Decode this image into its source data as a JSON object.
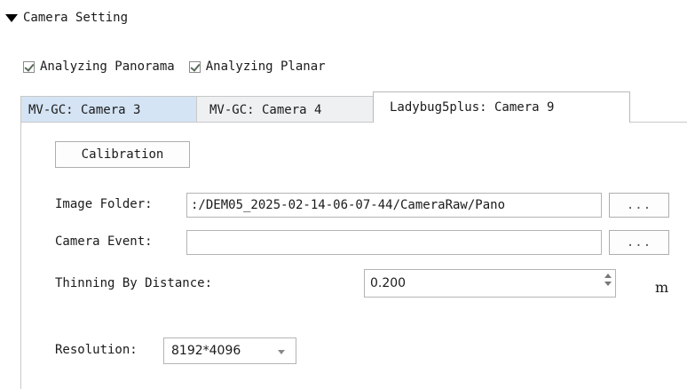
{
  "section": {
    "title": "Camera Setting"
  },
  "checkboxes": [
    {
      "label": "Analyzing Panorama",
      "checked": true
    },
    {
      "label": "Analyzing Planar",
      "checked": true
    }
  ],
  "tabs": [
    {
      "label": "MV-GC: Camera 3",
      "active": false
    },
    {
      "label": "MV-GC: Camera 4",
      "active": false
    },
    {
      "label": "Ladybug5plus: Camera 9",
      "active": true
    }
  ],
  "panel": {
    "calibration_label": "Calibration",
    "image_folder": {
      "label": "Image Folder:",
      "value": ":/DEM05_2025-02-14-06-07-44/CameraRaw/Pano",
      "browse_label": "..."
    },
    "camera_event": {
      "label": "Camera Event:",
      "value": "",
      "browse_label": "..."
    },
    "thinning": {
      "label": "Thinning By Distance:",
      "value": "0.200",
      "unit": "m"
    },
    "resolution": {
      "label": "Resolution:",
      "value": "8192*4096"
    }
  },
  "colors": {
    "inactive_tab_highlight": "#d4e4f4",
    "inactive_tab": "#eef0f2",
    "border": "#b4b4b4"
  },
  "icons": {
    "section_toggle": "caret-down-icon",
    "checkbox_mark": "checkmark-icon",
    "spin_up": "arrow-up-icon",
    "spin_down": "arrow-down-icon",
    "dropdown": "chevron-down-icon"
  }
}
